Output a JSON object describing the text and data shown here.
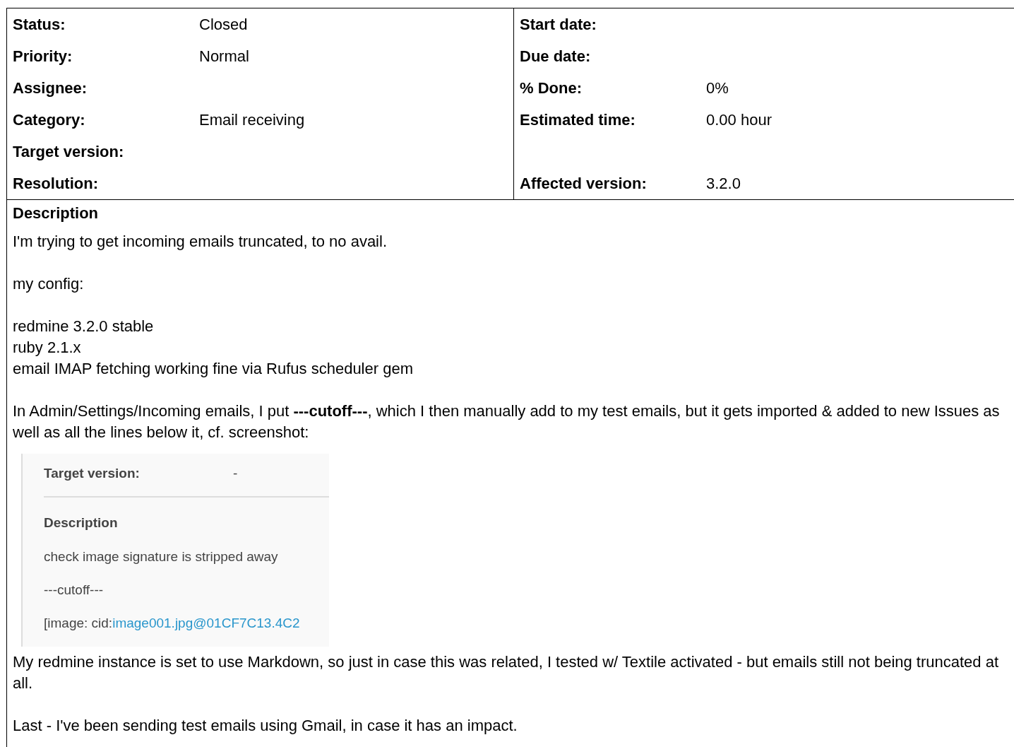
{
  "attributes": {
    "rows": [
      {
        "left": {
          "label": "Status:",
          "value": "Closed"
        },
        "right": {
          "label": "Start date:"
        }
      },
      {
        "left": {
          "label": "Priority:",
          "value": "Normal"
        },
        "right": {
          "label": "Due date:"
        }
      },
      {
        "left": {
          "label": "Assignee:"
        },
        "right": {
          "label": "% Done:",
          "value": "0%"
        }
      },
      {
        "left": {
          "label": "Category:",
          "value": "Email receiving"
        },
        "right": {
          "label": "Estimated time:",
          "value": "0.00 hour"
        }
      },
      {
        "left": {
          "label": "Target version:"
        }
      },
      {
        "left": {
          "label": "Resolution:"
        },
        "right": {
          "label": "Affected version:",
          "value": "3.2.0"
        }
      }
    ]
  },
  "description": {
    "heading": "Description",
    "blocks": [
      {
        "kind": "paragraph",
        "lines": [
          "I'm trying to get incoming emails truncated, to no avail."
        ]
      },
      {
        "kind": "paragraph",
        "lines": [
          "my config:"
        ]
      },
      {
        "kind": "paragraph",
        "lines": [
          "redmine 3.2.0 stable",
          "ruby 2.1.x",
          "email IMAP fetching working fine via Rufus scheduler gem"
        ]
      },
      {
        "kind": "paragraph",
        "lines": [
          "In Admin/Settings/Incoming emails, I put **---cutoff---**, which I then manually add to my test emails, but it gets imported & added to new Issues as well as all the lines below it, cf. screenshot:"
        ]
      },
      {
        "kind": "screenshot",
        "field": {
          "label": "Target version:",
          "value": "-"
        },
        "heading": "Description",
        "lines": [
          "check image signature is stripped away",
          "---cutoff---"
        ],
        "link_prefix": "[image: cid:",
        "link": "image001.jpg@01CF7C13.4C2"
      },
      {
        "kind": "paragraph",
        "lines": [
          "My redmine instance is set to use Markdown, so just in case this was related, I tested w/ Textile activated - but emails still not being truncated at all."
        ]
      },
      {
        "kind": "paragraph",
        "lines": [
          "Last - I've been sending test emails using Gmail, in case it has an impact."
        ]
      }
    ]
  }
}
